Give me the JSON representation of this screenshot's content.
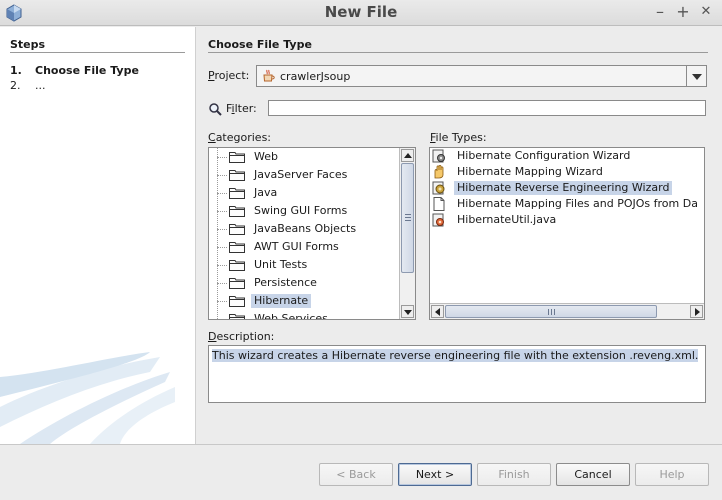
{
  "window": {
    "title": "New File",
    "controls": {
      "minimize": "–",
      "maximize": "+",
      "close": "✕"
    }
  },
  "steps": {
    "heading": "Steps",
    "items": [
      {
        "num": "1.",
        "label": "Choose File Type"
      },
      {
        "num": "2.",
        "label": "..."
      }
    ]
  },
  "panel": {
    "heading": "Choose File Type",
    "project_label_mnemonic": "P",
    "project_label_rest": "roject:",
    "project_value": "crawlerJsoup",
    "filter_label_pre": "F",
    "filter_label_mnemonic": "i",
    "filter_label_rest": "lter:",
    "filter_value": "",
    "categories_label_mnemonic": "C",
    "categories_label_rest": "ategories:",
    "categories": [
      "Web",
      "JavaServer Faces",
      "Java",
      "Swing GUI Forms",
      "JavaBeans Objects",
      "AWT GUI Forms",
      "Unit Tests",
      "Persistence",
      "Hibernate",
      "Web Services"
    ],
    "selected_category": "Hibernate",
    "file_types_label_mnemonic": "F",
    "file_types_label_rest": "ile Types:",
    "file_types": [
      {
        "label": "Hibernate Configuration Wizard",
        "icon": "config-wizard-icon"
      },
      {
        "label": "Hibernate Mapping Wizard",
        "icon": "mapping-wizard-icon"
      },
      {
        "label": "Hibernate Reverse Engineering Wizard",
        "icon": "reverse-engineering-icon"
      },
      {
        "label": "Hibernate Mapping Files and POJOs from Da",
        "icon": "mapping-files-icon"
      },
      {
        "label": "HibernateUtil.java",
        "icon": "java-file-icon"
      }
    ],
    "selected_file_type": "Hibernate Reverse Engineering Wizard",
    "description_label_mnemonic": "D",
    "description_label_rest": "escription:",
    "description": "This wizard creates a Hibernate reverse engineering file with the extension .reveng.xml."
  },
  "buttons": {
    "back": "< Back",
    "next": "Next >",
    "finish": "Finish",
    "cancel": "Cancel",
    "help": "Help"
  },
  "colors": {
    "selection": "#c7d4e8",
    "window_bg": "#ececec",
    "list_bg": "#ffffff"
  }
}
